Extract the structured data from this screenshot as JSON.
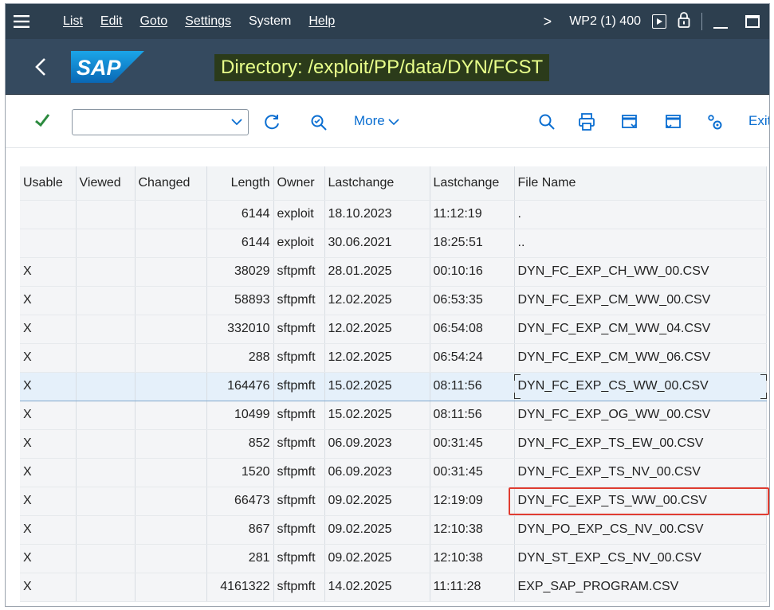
{
  "menu": {
    "items": [
      "List",
      "Edit",
      "Goto",
      "Settings",
      "System",
      "Help"
    ],
    "system_info": "WP2 (1) 400"
  },
  "title": {
    "text": "Directory: /exploit/PP/data/DYN/FCST",
    "highlight_color": "#2b3b1a",
    "text_color": "#e8ff8a"
  },
  "toolbar": {
    "command_value": "",
    "more_label": "More",
    "exit_label": "Exit"
  },
  "table": {
    "headers": [
      "Usable",
      "Viewed",
      "Changed",
      "Length",
      "Owner",
      "Lastchange",
      "Lastchange",
      "File Name"
    ],
    "rows": [
      [
        "",
        "",
        "",
        "6144",
        "exploit",
        "18.10.2023",
        "11:12:19",
        "."
      ],
      [
        "",
        "",
        "",
        "6144",
        "exploit",
        "30.06.2021",
        "18:25:51",
        ".."
      ],
      [
        "X",
        "",
        "",
        "38029",
        "sftpmft",
        "28.01.2025",
        "00:10:16",
        "DYN_FC_EXP_CH_WW_00.CSV"
      ],
      [
        "X",
        "",
        "",
        "58893",
        "sftpmft",
        "12.02.2025",
        "06:53:35",
        "DYN_FC_EXP_CM_WW_00.CSV"
      ],
      [
        "X",
        "",
        "",
        "332010",
        "sftpmft",
        "12.02.2025",
        "06:54:08",
        "DYN_FC_EXP_CM_WW_04.CSV"
      ],
      [
        "X",
        "",
        "",
        "288",
        "sftpmft",
        "12.02.2025",
        "06:54:24",
        "DYN_FC_EXP_CM_WW_06.CSV"
      ],
      [
        "X",
        "",
        "",
        "164476",
        "sftpmft",
        "15.02.2025",
        "08:11:56",
        "DYN_FC_EXP_CS_WW_00.CSV"
      ],
      [
        "X",
        "",
        "",
        "10499",
        "sftpmft",
        "15.02.2025",
        "08:11:56",
        "DYN_FC_EXP_OG_WW_00.CSV"
      ],
      [
        "X",
        "",
        "",
        "852",
        "sftpmft",
        "06.09.2023",
        "00:31:45",
        "DYN_FC_EXP_TS_EW_00.CSV"
      ],
      [
        "X",
        "",
        "",
        "1520",
        "sftpmft",
        "06.09.2023",
        "00:31:45",
        "DYN_FC_EXP_TS_NV_00.CSV"
      ],
      [
        "X",
        "",
        "",
        "66473",
        "sftpmft",
        "09.02.2025",
        "12:19:09",
        "DYN_FC_EXP_TS_WW_00.CSV"
      ],
      [
        "X",
        "",
        "",
        "867",
        "sftpmft",
        "09.02.2025",
        "12:10:38",
        "DYN_PO_EXP_CS_NV_00.CSV"
      ],
      [
        "X",
        "",
        "",
        "281",
        "sftpmft",
        "09.02.2025",
        "12:10:38",
        "DYN_ST_EXP_CS_NV_00.CSV"
      ],
      [
        "X",
        "",
        "",
        "4161322",
        "sftpmft",
        "14.02.2025",
        "11:11:28",
        "EXP_SAP_PROGRAM.CSV"
      ]
    ],
    "selected_row": 6,
    "highlighted_row": 10,
    "highlight_color": "#e03c31"
  }
}
